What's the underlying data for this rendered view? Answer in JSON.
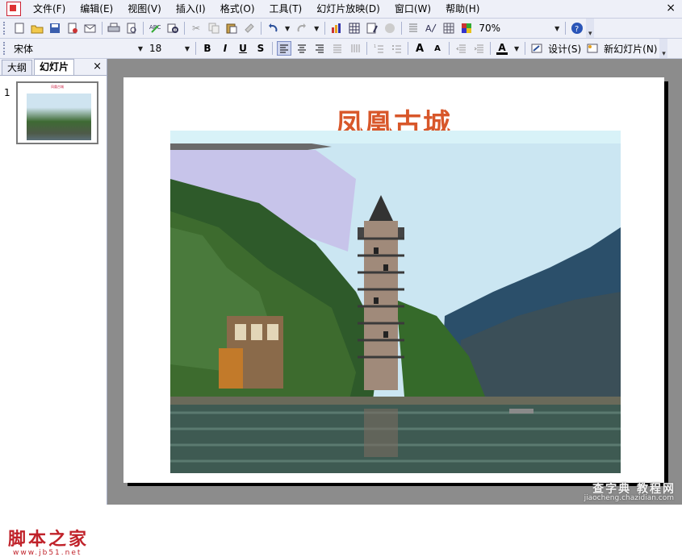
{
  "menubar": {
    "items": [
      "文件(F)",
      "编辑(E)",
      "视图(V)",
      "插入(I)",
      "格式(O)",
      "工具(T)",
      "幻灯片放映(D)",
      "窗口(W)",
      "帮助(H)"
    ],
    "close_label": "×"
  },
  "toolbar_standard": {
    "zoom_value": "70%"
  },
  "toolbar_format": {
    "font_name": "宋体",
    "font_size": "18",
    "bold": "B",
    "italic": "I",
    "underline": "U",
    "shadow": "S",
    "grow_font": "A",
    "shrink_font": "A",
    "font_color": "A",
    "design_label": "设计(S)",
    "new_slide_label": "新幻灯片(N)"
  },
  "pane": {
    "tabs": [
      "大纲",
      "幻灯片"
    ],
    "active_tab": "幻灯片",
    "close_label": "×",
    "thumbnail_number": "1"
  },
  "slide": {
    "title": "凤凰古城"
  },
  "watermarks": {
    "left_text": "脚本之家",
    "left_url": "www.jb51.net",
    "right_text": "查字典 教程网",
    "right_url": "jiaocheng.chazidian.com"
  },
  "colors": {
    "title": "#d8572a",
    "chrome": "#eef0f8",
    "editor_bg": "#8c8c8c"
  }
}
